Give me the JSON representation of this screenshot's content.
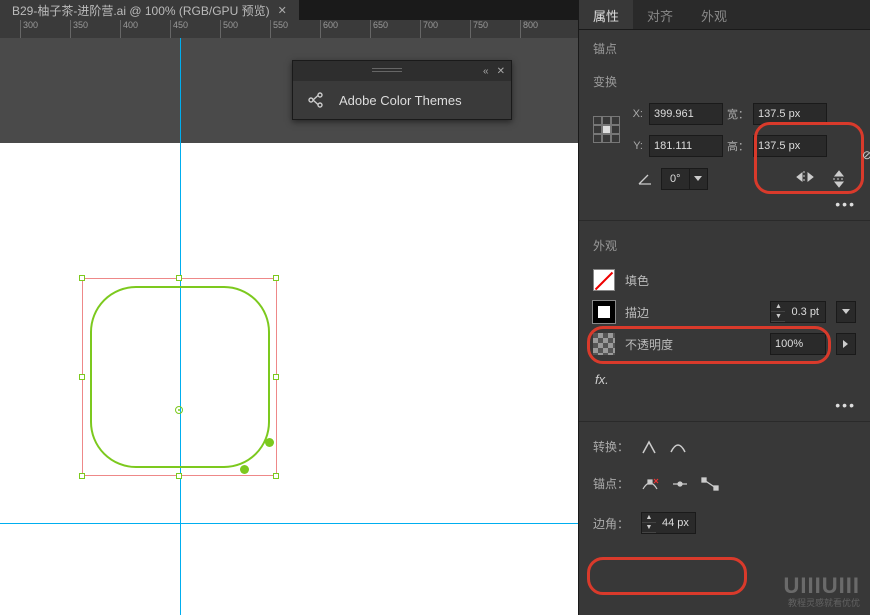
{
  "tab": {
    "title": "B29-柚子茶-进阶营.ai @ 100% (RGB/GPU 预览)"
  },
  "ruler": [
    "300",
    "350",
    "400",
    "450",
    "500",
    "550",
    "600",
    "650",
    "700",
    "750",
    "800"
  ],
  "floatPanel": {
    "title": "Adobe Color Themes"
  },
  "panelTabs": {
    "properties": "属性",
    "align": "对齐",
    "appearance": "外观"
  },
  "sections": {
    "anchorPt": "锚点",
    "transform": "变换",
    "appearance": "外观",
    "convert": "转换：",
    "anchors": "锚点：",
    "corner": "边角："
  },
  "transform": {
    "xLabel": "X:",
    "x": "399.961",
    "yLabel": "Y:",
    "y": "181.111",
    "wLabel": "宽：",
    "w": "137.5 px",
    "hLabel": "高：",
    "h": "137.5 px",
    "angle": "0°"
  },
  "appearance": {
    "fill": "填色",
    "stroke": "描边",
    "strokeVal": "0.3 pt",
    "opacity": "不透明度",
    "opacityVal": "100%",
    "fx": "fx."
  },
  "corner": {
    "value": "44 px"
  },
  "watermark": {
    "main": "UIIIUIII",
    "sub": "教程灵感就看优优"
  }
}
